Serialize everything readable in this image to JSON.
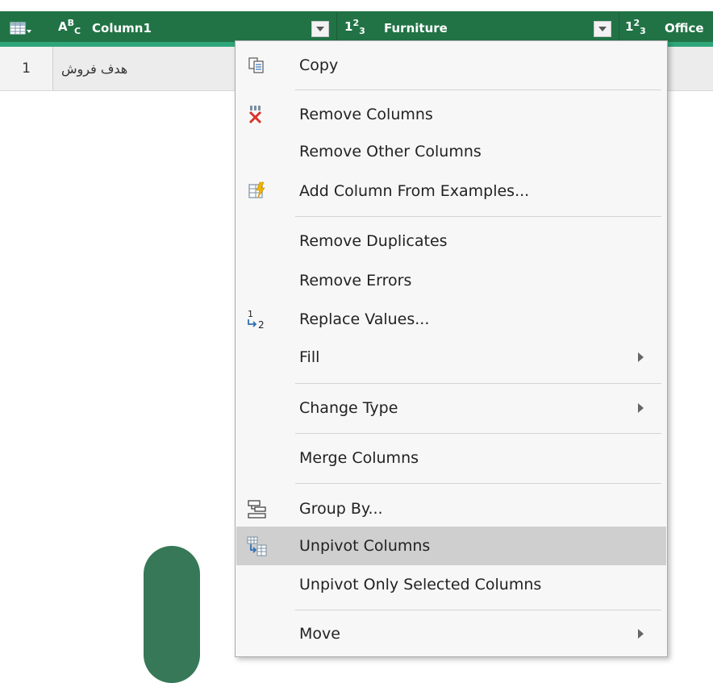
{
  "grid": {
    "columns": [
      {
        "type_icon": "ABC",
        "name": "Column1"
      },
      {
        "type_icon": "123",
        "name": "Furniture"
      },
      {
        "type_icon": "123",
        "name": "Office"
      }
    ],
    "rows": [
      {
        "number": "1",
        "column1": "هدف فروش"
      }
    ]
  },
  "context_menu": {
    "items": [
      {
        "label": "Copy",
        "icon": "copy-icon"
      },
      {
        "label": "Remove Columns",
        "icon": "remove-columns-icon"
      },
      {
        "label": "Remove Other Columns",
        "icon": ""
      },
      {
        "label": "Add Column From Examples...",
        "icon": "add-column-examples-icon"
      },
      {
        "label": "Remove Duplicates",
        "icon": ""
      },
      {
        "label": "Remove Errors",
        "icon": ""
      },
      {
        "label": "Replace Values...",
        "icon": "replace-values-icon"
      },
      {
        "label": "Fill",
        "icon": "",
        "submenu": true
      },
      {
        "label": "Change Type",
        "icon": "",
        "submenu": true
      },
      {
        "label": "Merge Columns",
        "icon": ""
      },
      {
        "label": "Group By...",
        "icon": "group-by-icon"
      },
      {
        "label": "Unpivot Columns",
        "icon": "unpivot-columns-icon",
        "highlighted": true
      },
      {
        "label": "Unpivot Only Selected Columns",
        "icon": ""
      },
      {
        "label": "Move",
        "icon": "",
        "submenu": true
      }
    ]
  },
  "colors": {
    "header_bg": "#217346",
    "header_accent": "#2ea67a",
    "menu_highlight": "#cfcfcf",
    "pill": "#367857"
  }
}
